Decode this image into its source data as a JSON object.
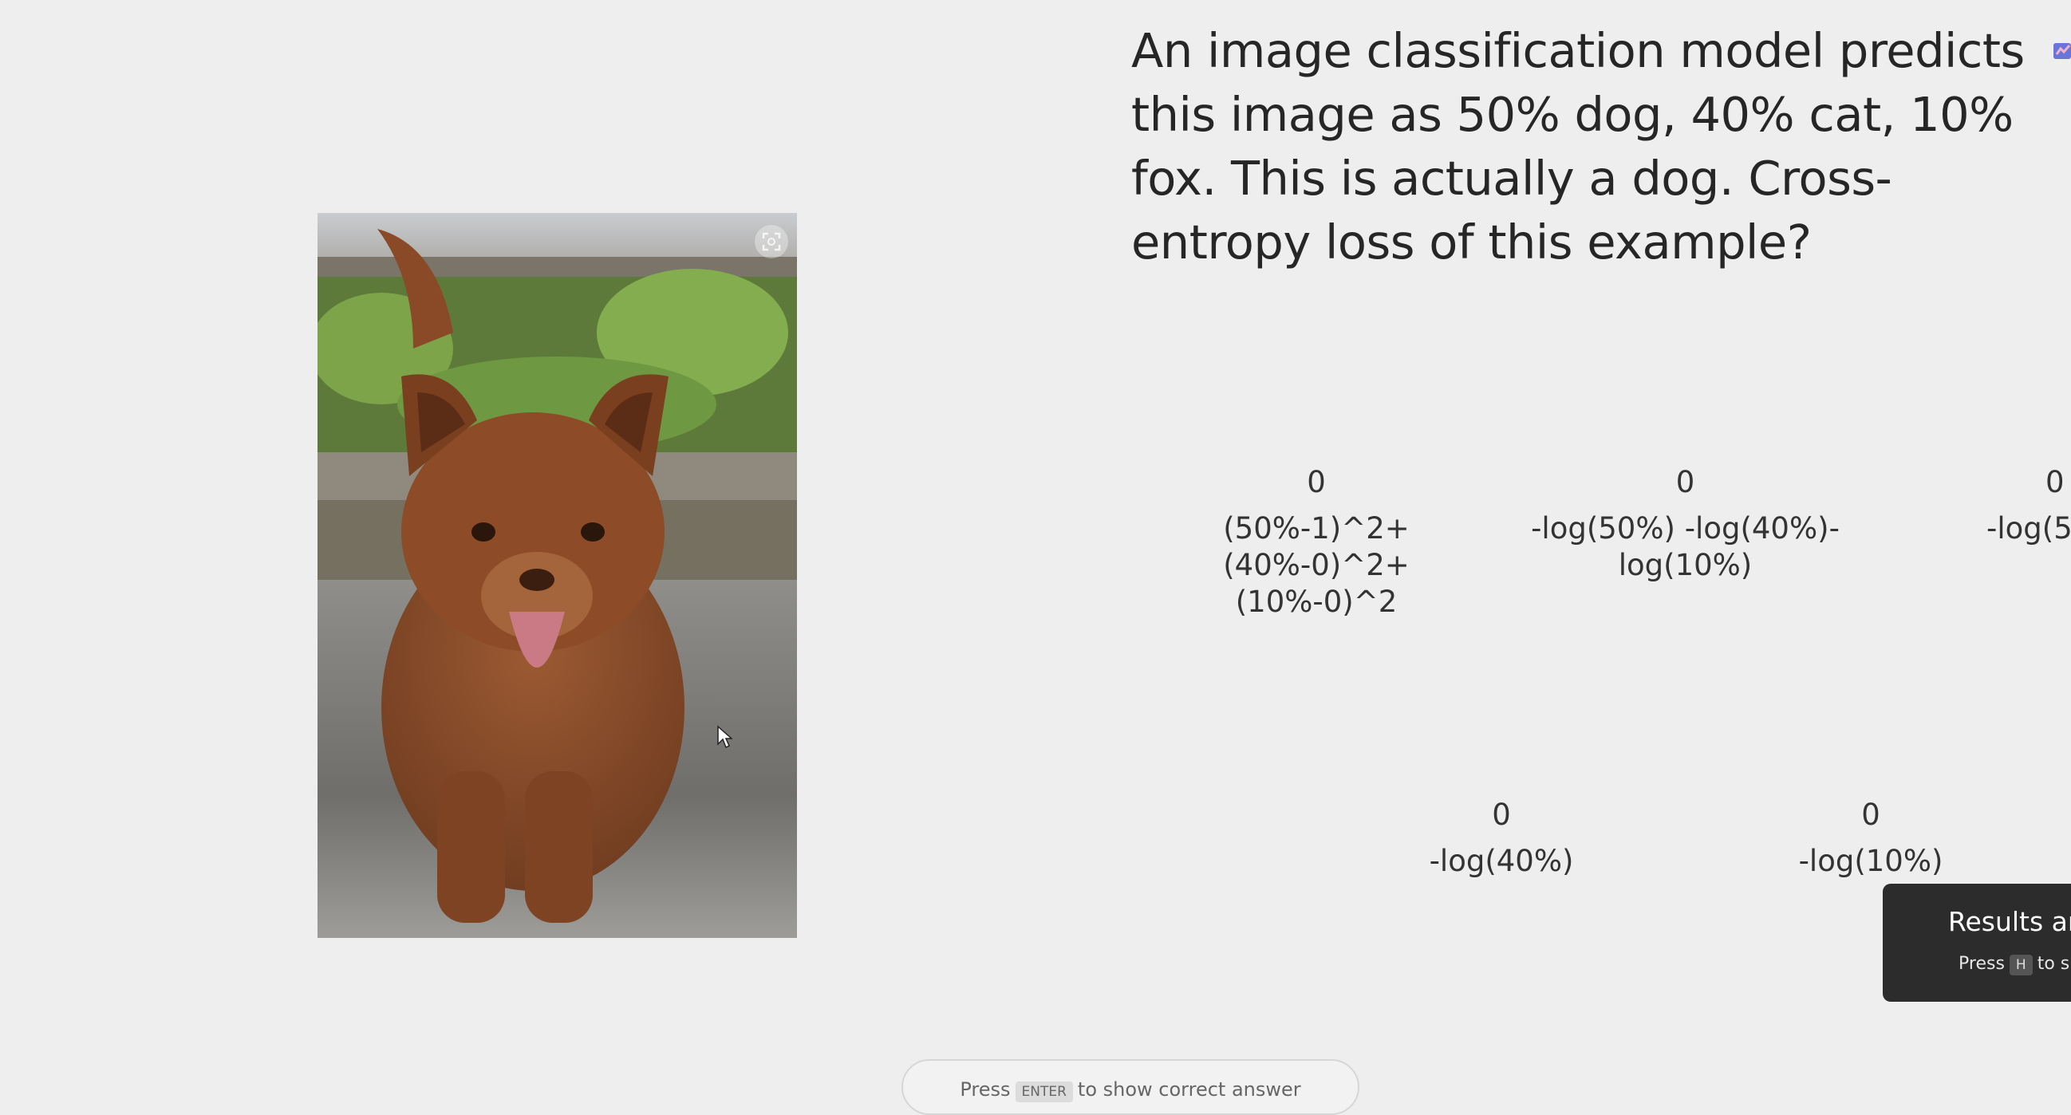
{
  "question": {
    "text": "An image classification model predicts this image as 50% dog, 40% cat, 10% fox. This is actually a dog. Cross-entropy loss of this example?"
  },
  "options": [
    {
      "count": "0",
      "label": "(50%-1)^2+(40%-0)^2+(10%-0)^2"
    },
    {
      "count": "0",
      "label": "-log(50%) -log(40%)-log(10%)"
    },
    {
      "count": "0",
      "label": "-log(5"
    },
    {
      "count": "0",
      "label": "-log(40%)"
    },
    {
      "count": "0",
      "label": "-log(10%)"
    }
  ],
  "toast": {
    "title": "Results ar",
    "hint_prefix": "Press",
    "hint_key": "H",
    "hint_suffix": "to s"
  },
  "bottom_hint": {
    "prefix": "Press",
    "key": "ENTER",
    "suffix": "to show correct answer"
  },
  "icons": {
    "fullscreen": "fullscreen-icon",
    "cursor": "mouse-cursor-icon",
    "corner": "chart-icon"
  },
  "colors": {
    "background": "#eeeeee",
    "toast_background": "#2c2c2c",
    "text": "#262626"
  }
}
